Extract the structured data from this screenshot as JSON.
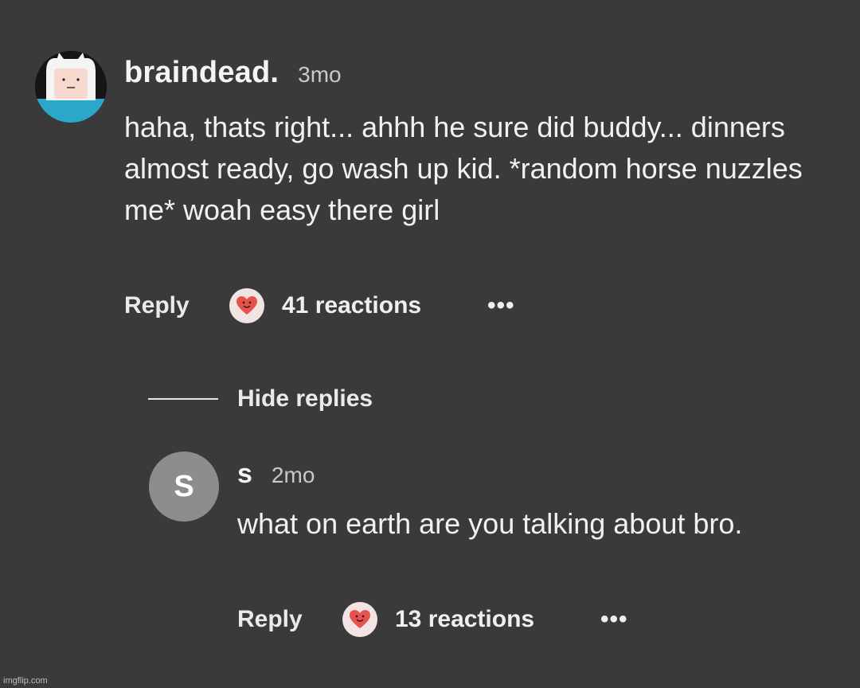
{
  "colors": {
    "background": "#3a3a3a",
    "text": "#f1f1f1",
    "muted": "#c9c9c9",
    "avatar_gray": "#8d8d8d",
    "heart": "#e8524d"
  },
  "comment": {
    "username": "braindead.",
    "timestamp": "3mo",
    "avatar_icon": "finn-avatar-icon",
    "body": "haha, thats right... ahhh he sure did buddy... dinners almost ready, go wash up kid. *random horse nuzzles me* woah easy there girl",
    "reply_label": "Reply",
    "reaction_icon": "heart-face-icon",
    "reactions": "41 reactions",
    "more_label": "•••"
  },
  "hide_replies_label": "Hide replies",
  "reply": {
    "avatar_letter": "S",
    "username": "s",
    "timestamp": "2mo",
    "body": "what on earth are you talking about bro.",
    "reply_label": "Reply",
    "reaction_icon": "heart-face-icon",
    "reactions": "13 reactions",
    "more_label": "•••"
  },
  "watermark": "imgflip.com"
}
